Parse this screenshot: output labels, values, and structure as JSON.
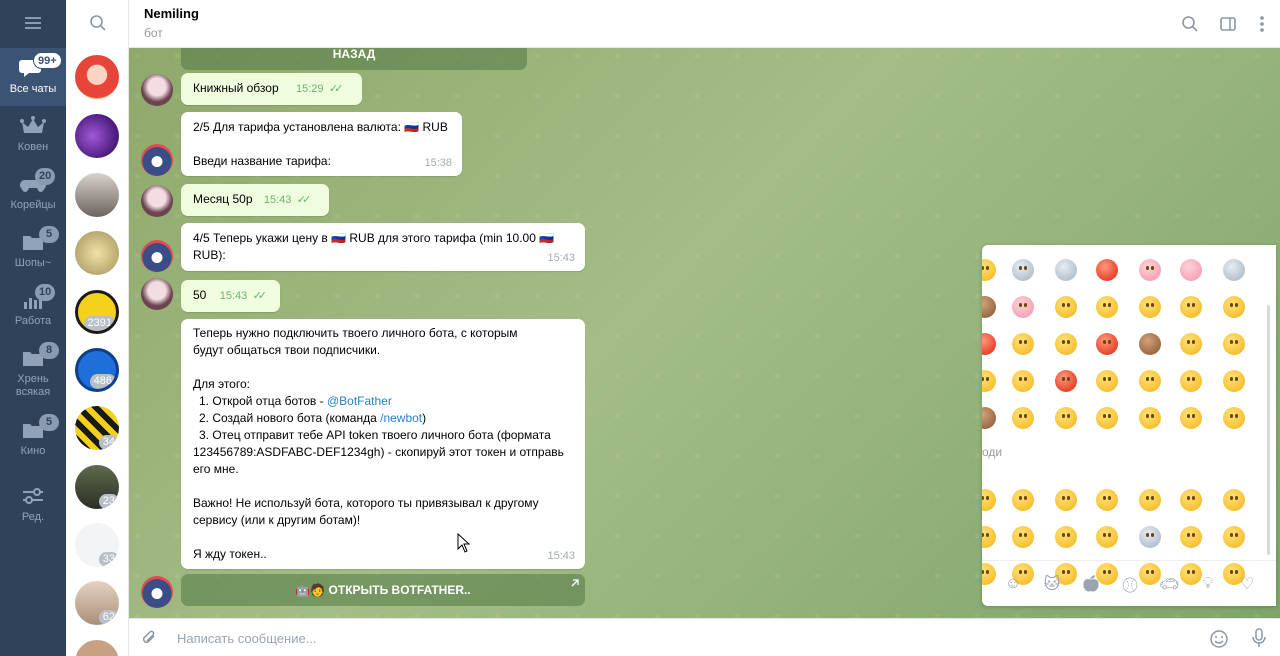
{
  "folders": [
    {
      "label": "Все чаты",
      "badge": "99+",
      "icon": "chat-bubbles-icon"
    },
    {
      "label": "Ковен",
      "badge": "",
      "icon": "crown-icon"
    },
    {
      "label": "Корейцы",
      "badge": "20",
      "icon": "gamepad-icon"
    },
    {
      "label": "Шопы~",
      "badge": "5",
      "icon": "folder-icon"
    },
    {
      "label": "Работа",
      "badge": "10",
      "icon": "chart-icon"
    },
    {
      "label": "Хрень всякая",
      "badge": "8",
      "icon": "folder-icon"
    },
    {
      "label": "Кино",
      "badge": "5",
      "icon": "folder-icon"
    },
    {
      "label": "Ред.",
      "badge": "",
      "icon": "sliders-icon"
    }
  ],
  "chatlist": {
    "counts": [
      "",
      "",
      "",
      "",
      "2391",
      "486",
      "34",
      "23",
      "33",
      "62"
    ]
  },
  "header": {
    "title": "Nemiling",
    "subtitle": "бот"
  },
  "messages": {
    "back_button": "НАЗАД",
    "m1": {
      "text": "Книжный обзор",
      "time": "15:29"
    },
    "m2": {
      "line1": "2/5 Для тарифа установлена валюта: 🇷🇺 RUB",
      "line2": "Введи название тарифа:",
      "time": "15:38"
    },
    "m3": {
      "text": "Месяц 50р",
      "time": "15:43"
    },
    "m4": {
      "line1": "4/5 Теперь укажи цену в 🇷🇺 RUB для этого тарифа (min 10.00 🇷🇺",
      "line2": "RUB):",
      "time": "15:43"
    },
    "m5": {
      "text": "50",
      "time": "15:43"
    },
    "m6": {
      "p1a": "Теперь нужно подключить твоего личного бота, с которым",
      "p1b": "будут общаться твои подписчики.",
      "p2": "Для этого:",
      "s1": "1. Открой отца ботов - ",
      "s1_link": "@BotFather",
      "s2": "2. Создай нового бота (команда ",
      "s2_link": "/newbot",
      "s2_end": ")",
      "s3a": "3. Отец отправит тебе API token твоего личного бота (формата",
      "s3b": "123456789:ASDFABC-DEF1234gh) - скопируй этот токен и отправь",
      "s3c": "его мне.",
      "p3a": "Важно! Не используй бота, которого ты привязывал к другому",
      "p3b": "сервису (или к другим ботам)!",
      "p4": "Я жду токен..",
      "time": "15:43"
    },
    "open_button": "🤖🧑 ОТКРЫТЬ BOTFATHER.."
  },
  "emoji_panel": {
    "category_label": "оди"
  },
  "composer": {
    "placeholder": "Написать сообщение..."
  },
  "colors": {
    "rail": "#30425a",
    "accent": "#2481cc",
    "outgoing": "#effdde",
    "check": "#5fb86b"
  }
}
